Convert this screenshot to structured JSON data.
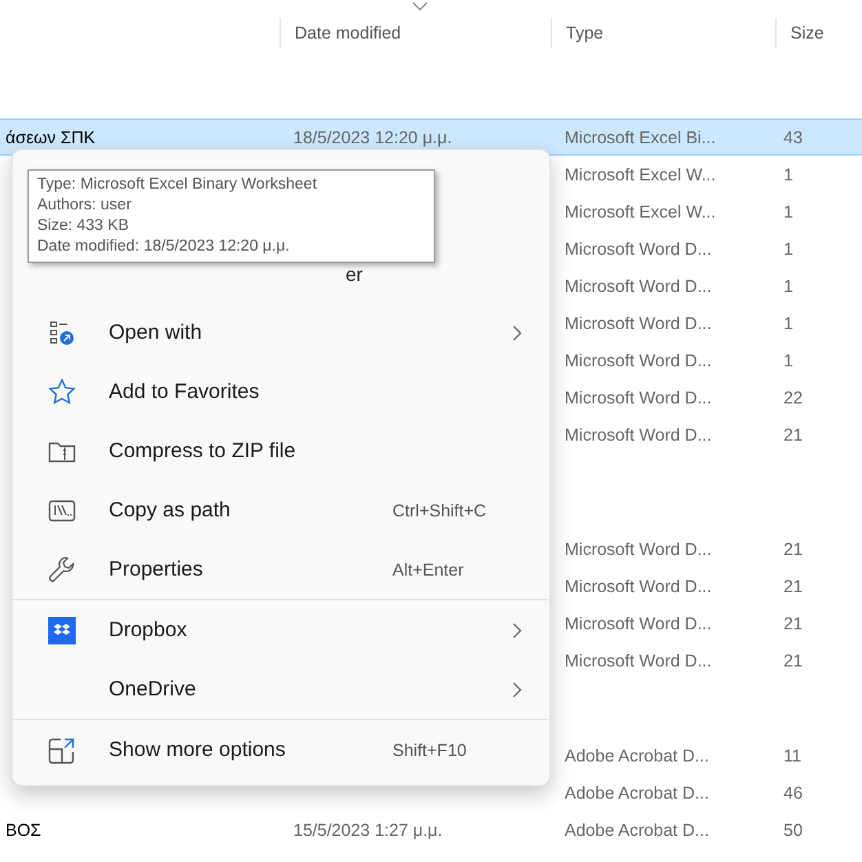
{
  "columns": [
    {
      "label": "Date modified",
      "sorted": true
    },
    {
      "label": "Type",
      "sorted": false
    },
    {
      "label": "Size",
      "sorted": false
    }
  ],
  "rows": [
    {
      "kind": "file",
      "name": "άσεων ΣΠΚ",
      "date": "18/5/2023 12:20 μ.μ.",
      "type": "Microsoft Excel Bi...",
      "size": "43",
      "selected": true
    },
    {
      "kind": "file",
      "type": "Microsoft Excel W...",
      "size": "1",
      "selected": false
    },
    {
      "kind": "file",
      "type": "Microsoft Excel W...",
      "size": "1",
      "selected": false
    },
    {
      "kind": "file",
      "type": "Microsoft Word D...",
      "size": "1",
      "selected": false
    },
    {
      "kind": "file",
      "type": "Microsoft Word D...",
      "size": "1",
      "selected": false
    },
    {
      "kind": "file",
      "type": "Microsoft Word D...",
      "size": "1",
      "selected": false
    },
    {
      "kind": "file",
      "type": "Microsoft Word D...",
      "size": "1",
      "selected": false
    },
    {
      "kind": "file",
      "type": "Microsoft Word D...",
      "size": "22",
      "selected": false
    },
    {
      "kind": "file",
      "type": "Microsoft Word D...",
      "size": "21",
      "selected": false
    },
    {
      "kind": "gap"
    },
    {
      "kind": "gap"
    },
    {
      "kind": "gap"
    },
    {
      "kind": "gap"
    },
    {
      "kind": "file",
      "type": "Microsoft Word D...",
      "size": "21",
      "selected": false
    },
    {
      "kind": "file",
      "type": "Microsoft Word D...",
      "size": "21",
      "selected": false
    },
    {
      "kind": "file",
      "type": "Microsoft Word D...",
      "size": "21",
      "selected": false
    },
    {
      "kind": "file",
      "type": "Microsoft Word D...",
      "size": "21",
      "selected": false
    },
    {
      "kind": "gap"
    },
    {
      "kind": "gap"
    },
    {
      "kind": "gap"
    },
    {
      "kind": "file",
      "type": "Adobe Acrobat D...",
      "size": "11",
      "selected": false
    },
    {
      "kind": "file",
      "type": "Adobe Acrobat D...",
      "size": "46",
      "selected": false
    },
    {
      "kind": "file",
      "name": "ΒΟΣ",
      "date": "15/5/2023 1:27 μ.μ.",
      "type": "Adobe Acrobat D...",
      "size": "50",
      "selected": false
    }
  ],
  "context_menu": {
    "partial_item": "er",
    "items": [
      {
        "kind": "item",
        "label": "Open with",
        "submenu": true
      },
      {
        "kind": "item",
        "label": "Add to Favorites",
        "submenu": false
      },
      {
        "kind": "item",
        "label": "Compress to ZIP file",
        "submenu": false
      },
      {
        "kind": "item",
        "label": "Copy as path",
        "shortcut": "Ctrl+Shift+C",
        "submenu": false
      },
      {
        "kind": "item",
        "label": "Properties",
        "shortcut": "Alt+Enter",
        "submenu": false
      },
      {
        "kind": "separator"
      },
      {
        "kind": "item",
        "label": "Dropbox",
        "submenu": true
      },
      {
        "kind": "item",
        "label": "OneDrive",
        "submenu": true
      },
      {
        "kind": "separator"
      },
      {
        "kind": "item",
        "label": "Show more options",
        "shortcut": "Shift+F10",
        "submenu": false
      }
    ]
  },
  "tooltip": {
    "lines": [
      "Type: Microsoft Excel Binary Worksheet",
      "Authors: user",
      "Size: 433 KB",
      "Date modified: 18/5/2023 12:20 μ.μ."
    ]
  }
}
